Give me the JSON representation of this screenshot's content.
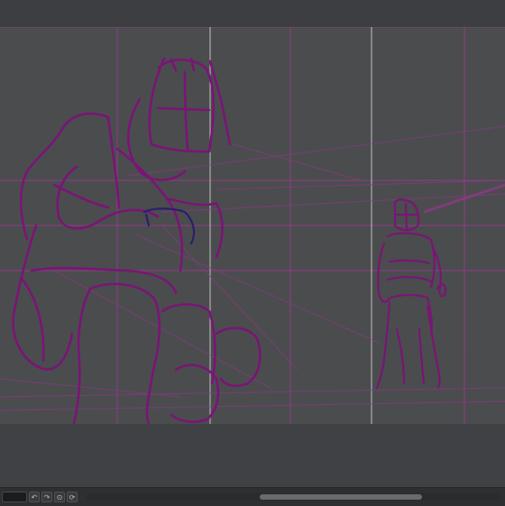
{
  "app": {
    "accent_color": "#c72fb2",
    "sketch_color": "#7a1576",
    "canvas_color": "#4b4c4e"
  },
  "canvas": {
    "content": "rough-sketch-kneeling-knight-and-standing-figure"
  },
  "status_bar": {
    "tools": [
      {
        "name": "undo-icon",
        "glyph": "↶"
      },
      {
        "name": "redo-icon",
        "glyph": "↷"
      },
      {
        "name": "zoom-icon",
        "glyph": "⊙"
      },
      {
        "name": "rotate-icon",
        "glyph": "⟳"
      }
    ]
  }
}
